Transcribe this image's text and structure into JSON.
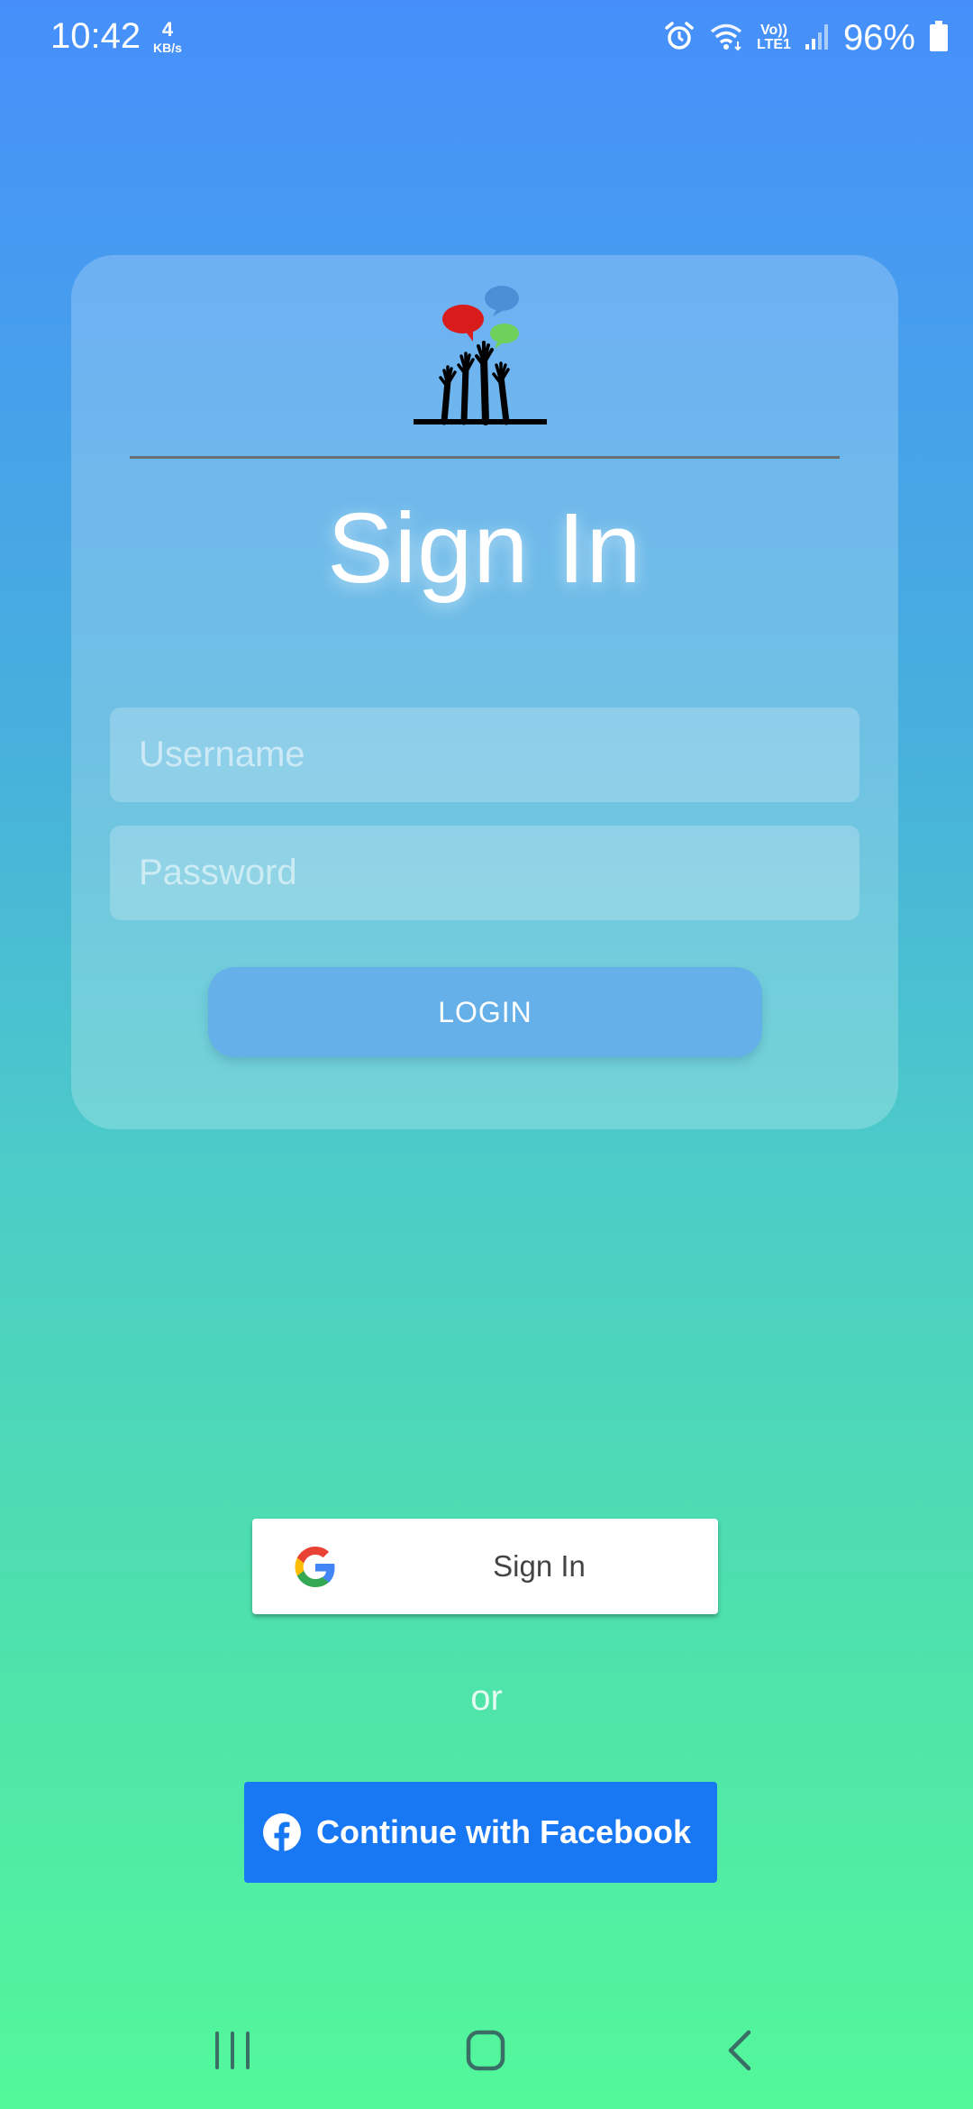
{
  "status_bar": {
    "time": "10:42",
    "net_speed_value": "4",
    "net_speed_unit": "KB/s",
    "lte_top": "Vo))",
    "lte_bottom": "LTE1",
    "battery_percent": "96%",
    "icons": [
      "alarm-icon",
      "wifi-icon",
      "signal-icon",
      "battery-icon"
    ]
  },
  "card": {
    "logo": "hands-speech-bubbles-logo",
    "title": "Sign In",
    "username_placeholder": "Username",
    "password_placeholder": "Password",
    "login_label": "LOGIN"
  },
  "google_button": {
    "icon": "google-icon",
    "label": "Sign In"
  },
  "separator_text": "or",
  "facebook_button": {
    "icon": "facebook-icon",
    "label": "Continue with Facebook",
    "color": "#1877f2"
  },
  "nav_bar": {
    "icons": [
      "recent-apps-icon",
      "home-icon",
      "back-icon"
    ]
  },
  "colors": {
    "gradient_top": "#468ffb",
    "gradient_bottom": "#52f89a",
    "login_button": "#65b0e8"
  }
}
